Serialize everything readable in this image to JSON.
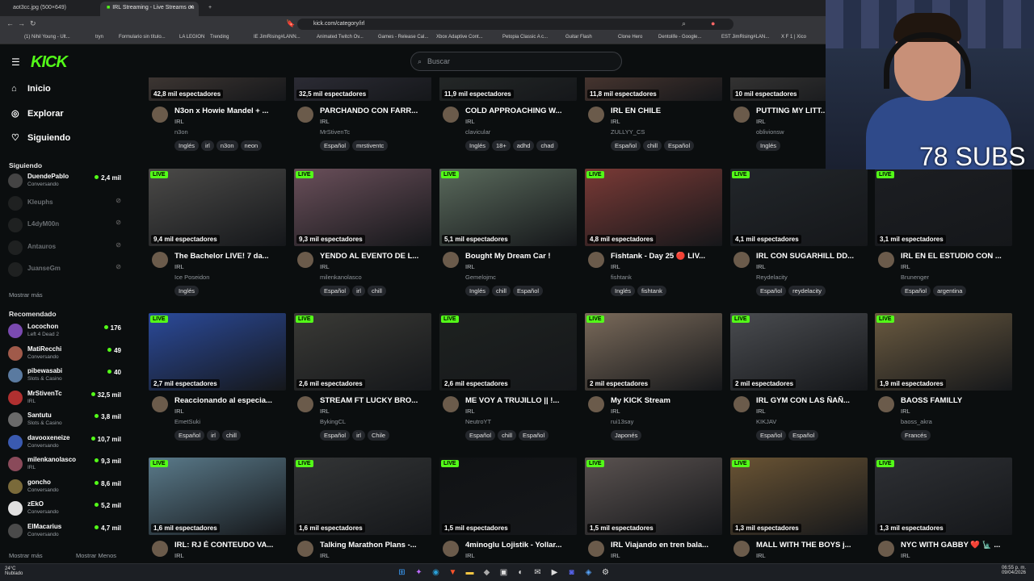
{
  "browser": {
    "tabs": [
      "aot3cc.jpg (500×649)",
      "IRL Streaming - Live Streams on"
    ],
    "url": "kick.com/category/irl",
    "bookmarks": [
      "(1) Nihil Young - Ult...",
      "tryn",
      "Formulario sin título...",
      "LA LEGION",
      "Trending",
      "IE JimRising#LANN...",
      "Animated Twitch Ov...",
      "Games - Release Cal...",
      "Xbox Adaptive Cont...",
      "Petopia Classic A c...",
      "Guitar Flash",
      "Clone Hero",
      "Dentolife - Google...",
      "EST JimRising#LAN...",
      "X F 1 | Xico"
    ]
  },
  "site": {
    "logo": "KICK",
    "search_placeholder": "Buscar"
  },
  "nav": [
    {
      "label": "Inicio",
      "icon": "home-icon"
    },
    {
      "label": "Explorar",
      "icon": "compass-icon"
    },
    {
      "label": "Siguiendo",
      "icon": "heart-icon"
    }
  ],
  "following": {
    "title": "Siguiendo",
    "items": [
      {
        "name": "DuendePablo",
        "cat": "Conversando",
        "viewers": "2,4 mil",
        "online": true
      },
      {
        "name": "Kleuphs",
        "cat": "",
        "viewers": "",
        "online": false
      },
      {
        "name": "L4dyM00n",
        "cat": "",
        "viewers": "",
        "online": false
      },
      {
        "name": "Antauros",
        "cat": "",
        "viewers": "",
        "online": false
      },
      {
        "name": "JuanseGm",
        "cat": "",
        "viewers": "",
        "online": false
      }
    ],
    "more": "Mostrar más"
  },
  "recommended": {
    "title": "Recomendado",
    "items": [
      {
        "name": "Locochon",
        "cat": "Left 4 Dead 2",
        "viewers": "176"
      },
      {
        "name": "MatiRecchi",
        "cat": "Conversando",
        "viewers": "49"
      },
      {
        "name": "pibewasabi",
        "cat": "Slots & Casino",
        "viewers": "40"
      },
      {
        "name": "MrStivenTc",
        "cat": "IRL",
        "viewers": "32,5 mil"
      },
      {
        "name": "Santutu",
        "cat": "Slots & Casino",
        "viewers": "3,8 mil"
      },
      {
        "name": "davooxeneize",
        "cat": "Conversando",
        "viewers": "10,7 mil"
      },
      {
        "name": "milenkanolasco",
        "cat": "IRL",
        "viewers": "9,3 mil"
      },
      {
        "name": "goncho",
        "cat": "Conversando",
        "viewers": "8,6 mil"
      },
      {
        "name": "zEkO",
        "cat": "Conversando",
        "viewers": "5,2 mil"
      },
      {
        "name": "ElMacarius",
        "cat": "Conversando",
        "viewers": "4,7 mil"
      }
    ],
    "more": "Mostrar más",
    "less": "Mostrar Menos"
  },
  "live_label": "LIVE",
  "rows": [
    [
      {
        "title": "N3on x Howie Mandel + ...",
        "cat": "IRL",
        "streamer": "n3on",
        "viewers": "42,8 mil espectadores",
        "tags": [
          "Inglés",
          "irl",
          "n3on",
          "neon"
        ],
        "color": "#5a4c44"
      },
      {
        "title": "PARCHANDO CON FARR...",
        "cat": "IRL",
        "streamer": "MrStivenTc",
        "viewers": "32,5 mil espectadores",
        "tags": [
          "Español",
          "mrstiventc"
        ],
        "color": "#3c3a48"
      },
      {
        "title": "COLD APPROACHING W...",
        "cat": "IRL",
        "streamer": "clavicular",
        "viewers": "11,9 mil espectadores",
        "tags": [
          "Inglés",
          "18+",
          "adhd",
          "chad"
        ],
        "color": "#2e3330"
      },
      {
        "title": "IRL EN CHILE",
        "cat": "IRL",
        "streamer": "ZULLYY_CS",
        "viewers": "11,8 mil espectadores",
        "tags": [
          "Español",
          "chill",
          "Español"
        ],
        "color": "#6a4a3e"
      },
      {
        "title": "PUTTING MY LITT...",
        "cat": "IRL",
        "streamer": "oblivionsw",
        "viewers": "10 mil espectadores",
        "tags": [
          "Inglés"
        ],
        "color": "#4a4744"
      },
      null
    ],
    [
      {
        "title": "The Bachelor LIVE! 7 da...",
        "cat": "IRL",
        "streamer": "Ice Poseidon",
        "viewers": "9,4 mil espectadores",
        "tags": [
          "Inglés"
        ],
        "color": "#4b4a48"
      },
      {
        "title": "YENDO AL EVENTO DE L...",
        "cat": "IRL",
        "streamer": "milenkanolasco",
        "viewers": "9,3 mil espectadores",
        "tags": [
          "Español",
          "irl",
          "chill"
        ],
        "color": "#6a4f5a"
      },
      {
        "title": "Bought My Dream Car !",
        "cat": "IRL",
        "streamer": "Gemelojmc",
        "viewers": "5,1 mil espectadores",
        "tags": [
          "Inglés",
          "chill",
          "Español"
        ],
        "color": "#5a6a5c"
      },
      {
        "title": "Fishtank - Day 25 🔴 LIV...",
        "cat": "IRL",
        "streamer": "fishtank",
        "viewers": "4,8 mil espectadores",
        "tags": [
          "Inglés",
          "fishtank"
        ],
        "color": "#7a3a36"
      },
      {
        "title": "IRL CON SUGARHILL DD...",
        "cat": "IRL",
        "streamer": "Reydelacity",
        "viewers": "4,1 mil espectadores",
        "tags": [
          "Español",
          "reydelacity"
        ],
        "color": "#22262a"
      },
      {
        "title": "IRL EN EL ESTUDIO CON ...",
        "cat": "IRL",
        "streamer": "Brunenger",
        "viewers": "3,1 mil espectadores",
        "tags": [
          "Español",
          "argentina"
        ],
        "color": "#1c1e22"
      }
    ],
    [
      {
        "title": "Reaccionando al especia...",
        "cat": "IRL",
        "streamer": "EmetSuki",
        "viewers": "2,7 mil espectadores",
        "tags": [
          "Español",
          "irl",
          "chill"
        ],
        "color": "#2b4a9a"
      },
      {
        "title": "STREAM FT LUCKY BRO...",
        "cat": "IRL",
        "streamer": "BykingCL",
        "viewers": "2,6 mil espectadores",
        "tags": [
          "Español",
          "irl",
          "Chile"
        ],
        "color": "#3a3a36"
      },
      {
        "title": "ME VOY A TRUJILLO || !...",
        "cat": "IRL",
        "streamer": "NeutroYT",
        "viewers": "2,6 mil espectadores",
        "tags": [
          "Español",
          "chill",
          "Español"
        ],
        "color": "#1e2220"
      },
      {
        "title": "My KICK Stream",
        "cat": "IRL",
        "streamer": "rui13say",
        "viewers": "2 mil espectadores",
        "tags": [
          "Japonés"
        ],
        "color": "#7a6a5a"
      },
      {
        "title": "IRL GYM CON LAS ÑAÑ...",
        "cat": "IRL",
        "streamer": "KIKJAV",
        "viewers": "2 mil espectadores",
        "tags": [
          "Español",
          "Español"
        ],
        "color": "#4a4c50"
      },
      {
        "title": "BAOSS FAMILLY",
        "cat": "IRL",
        "streamer": "baoss_akra",
        "viewers": "1,9 mil espectadores",
        "tags": [
          "Francés"
        ],
        "color": "#6a5a40"
      }
    ],
    [
      {
        "title": "IRL: RJ É CONTEUDO VA...",
        "cat": "IRL",
        "streamer": "",
        "viewers": "1,6 mil espectadores",
        "tags": [],
        "color": "#5a7a8a"
      },
      {
        "title": "Talking Marathon Plans -...",
        "cat": "IRL",
        "streamer": "",
        "viewers": "1,6 mil espectadores",
        "tags": [],
        "color": "#333536"
      },
      {
        "title": "4minoglu Lojistik - Yollar...",
        "cat": "IRL",
        "streamer": "",
        "viewers": "1,5 mil espectadores",
        "tags": [],
        "color": "#101214"
      },
      {
        "title": "IRL Viajando en tren bala...",
        "cat": "IRL",
        "streamer": "",
        "viewers": "1,5 mil espectadores",
        "tags": [],
        "color": "#5a5250"
      },
      {
        "title": "MALL WITH THE BOYS j...",
        "cat": "IRL",
        "streamer": "",
        "viewers": "1,3 mil espectadores",
        "tags": [],
        "color": "#6a5434"
      },
      {
        "title": "NYC WITH GABBY ❤️ 🗽 ...",
        "cat": "IRL",
        "streamer": "",
        "viewers": "1,3 mil espectadores",
        "tags": [],
        "color": "#2e3034"
      }
    ]
  ],
  "overlay": {
    "subs": "78 SUBS"
  },
  "taskbar": {
    "temp": "24°C",
    "weather": "Nublado",
    "time": "06:55 p. m.",
    "date": "09/04/2026"
  }
}
